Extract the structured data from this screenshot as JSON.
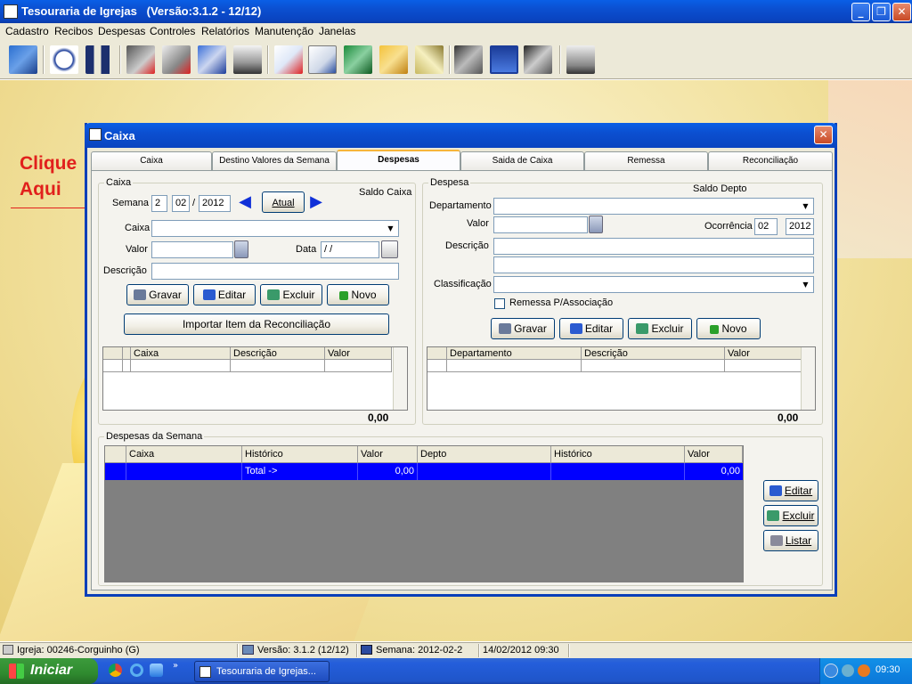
{
  "app": {
    "title": "Tesouraria de Igrejas   (Versão:3.1.2 - 12/12)"
  },
  "menu": [
    "Cadastro",
    "Recibos",
    "Despesas",
    "Controles",
    "Relatórios",
    "Manutenção",
    "Janelas"
  ],
  "annotation": {
    "line1": "Clique",
    "line2": "Aqui",
    "color": "#e1201c"
  },
  "dialog": {
    "title": "Caixa",
    "tabs": [
      "Caixa",
      "Destino Valores da Semana",
      "Despesas",
      "Saida de Caixa",
      "Remessa",
      "Reconciliação"
    ],
    "active_tab": "Despesas",
    "caixa": {
      "legend": "Caixa",
      "semana_label": "Semana",
      "semana_num": "2",
      "semana_mes": "02",
      "semana_sep": "/",
      "semana_ano": "2012",
      "atual_label": "Atual",
      "saldo_label": "Saldo Caixa",
      "caixa_label": "Caixa",
      "valor_label": "Valor",
      "data_label": "Data",
      "data_value": " /  /",
      "descricao_label": "Descrição",
      "gravar": "Gravar",
      "editar": "Editar",
      "excluir": "Excluir",
      "novo": "Novo",
      "importar": "Importar Item da Reconciliação",
      "grid_headers": [
        "Caixa",
        "Descrição",
        "Valor"
      ],
      "total": "0,00"
    },
    "despesa": {
      "legend": "Despesa",
      "saldo_label": "Saldo Depto",
      "departamento_label": "Departamento",
      "valor_label": "Valor",
      "ocorrencia_label": "Ocorrência",
      "ocorrencia_mes": "02",
      "ocorrencia_ano": "2012",
      "descricao_label": "Descrição",
      "classificacao_label": "Classificação",
      "remessa_label": "Remessa P/Associação",
      "gravar": "Gravar",
      "editar": "Editar",
      "excluir": "Excluir",
      "novo": "Novo",
      "grid_headers": [
        "Departamento",
        "Descrição",
        "Valor"
      ],
      "total": "0,00"
    },
    "semana": {
      "legend": "Despesas da Semana",
      "headers": [
        "Caixa",
        "Histórico",
        "Valor",
        "Depto",
        "Histórico",
        "Valor"
      ],
      "row": {
        "caixa": "",
        "historico": "Total ->",
        "valor": "0,00",
        "depto": "",
        "historico2": "",
        "valor2": "0,00"
      },
      "editar": "Editar",
      "excluir": "Excluir",
      "listar": "Listar"
    }
  },
  "status": {
    "igreja": "Igreja: 00246-Corguinho (G)",
    "versao": "Versão: 3.1.2 (12/12)",
    "semana": "Semana: 2012-02-2",
    "datahora": "14/02/2012  09:30"
  },
  "taskbar": {
    "start": "Iniciar",
    "task": "Tesouraria de Igrejas...",
    "clock": "09:30"
  },
  "colors": {
    "titlebar": "#0a4fd0",
    "selection": "#0000ff",
    "dialog_bg": "#ece9d8"
  }
}
